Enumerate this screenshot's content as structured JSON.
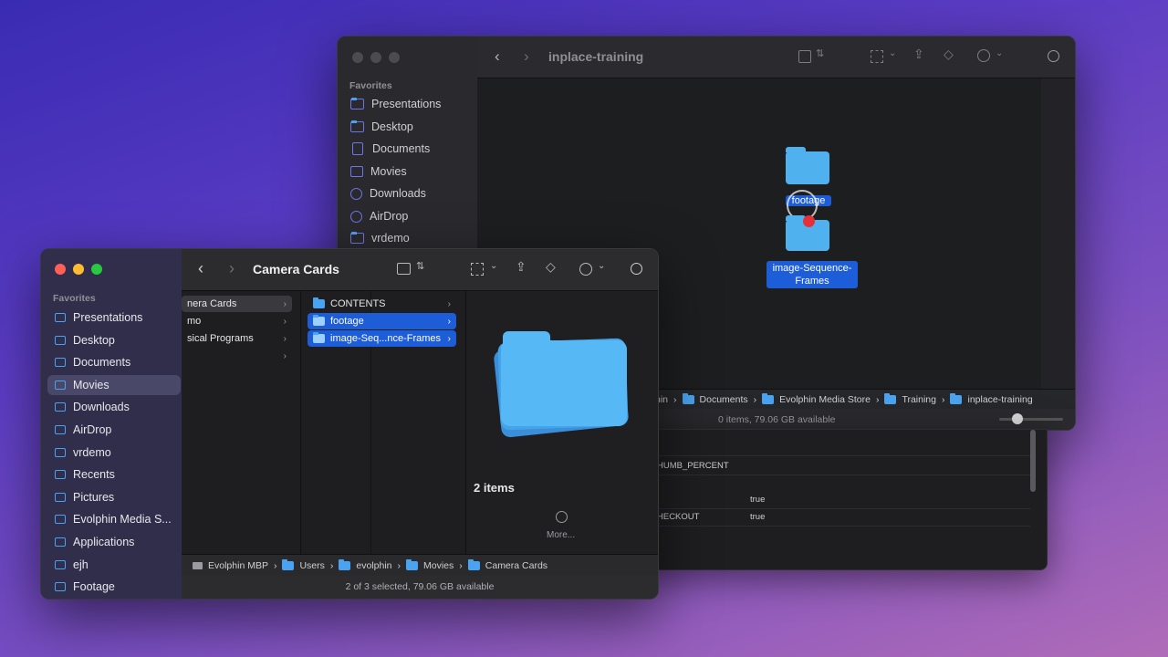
{
  "back_window": {
    "title": "inplace-training",
    "sidebar_heading": "Favorites",
    "sidebar_items": [
      "Presentations",
      "Desktop",
      "Documents",
      "Movies",
      "Downloads",
      "AirDrop",
      "vrdemo"
    ],
    "icons": [
      {
        "name": "footage",
        "label": "footage"
      },
      {
        "name": "image-sequence",
        "label": "image-Sequence-Frames"
      }
    ],
    "path_bar": [
      "hin",
      "Documents",
      "Evolphin Media Store",
      "Training",
      "inplace-training"
    ],
    "status": "0 items, 79.06 GB available",
    "list_rows": [
      {
        "col1": "HUMB_PERCENT",
        "col2": ""
      },
      {
        "col1": "",
        "col2": "true"
      },
      {
        "col1": "HECKOUT",
        "col2": "true"
      }
    ]
  },
  "front_window": {
    "title": "Camera Cards",
    "sidebar_heading": "Favorites",
    "sidebar_items": [
      "Presentations",
      "Desktop",
      "Documents",
      "Movies",
      "Downloads",
      "AirDrop",
      "vrdemo",
      "Recents",
      "Pictures",
      "Evolphin Media S...",
      "Applications",
      "ejh",
      "Footage"
    ],
    "sidebar_selected": "Movies",
    "col1_items": [
      "nera Cards",
      "mo",
      "sical Programs",
      ""
    ],
    "col2_items": [
      {
        "label": "CONTENTS",
        "selected": false
      },
      {
        "label": "footage",
        "selected": true
      },
      {
        "label": "image-Seq...nce-Frames",
        "selected": true
      }
    ],
    "preview_count": "2 items",
    "more_label": "More...",
    "path_bar": [
      "Evolphin MBP",
      "Users",
      "evolphin",
      "Movies",
      "Camera Cards"
    ],
    "status": "2 of 3 selected, 79.06 GB available"
  },
  "colors": {
    "accent": "#1e5dd8",
    "folder": "#4aa3f0"
  }
}
